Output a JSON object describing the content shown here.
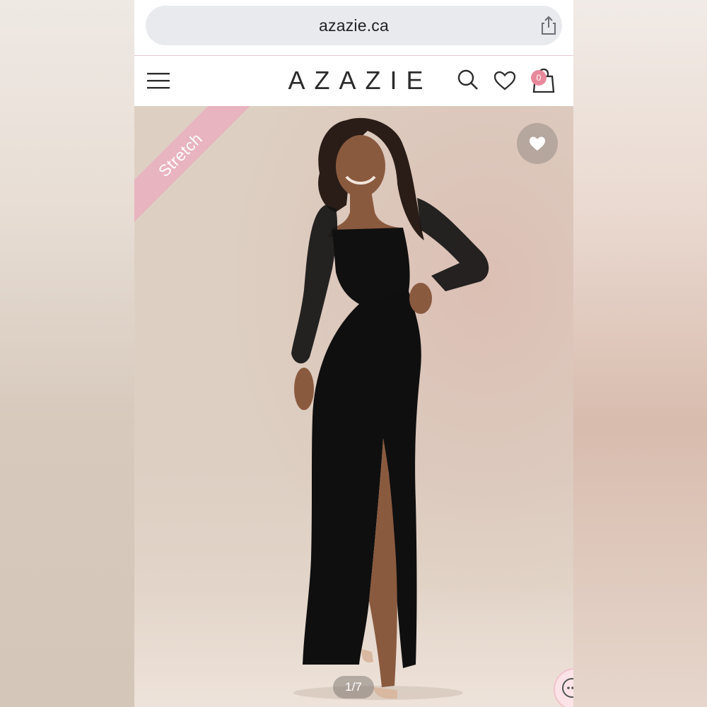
{
  "browser": {
    "url": "azazie.ca"
  },
  "header": {
    "brand": "AZAZIE",
    "cart_count": "0"
  },
  "hero": {
    "badge": "Stretch",
    "pager": "1/7"
  },
  "colors": {
    "accent_pink": "#e8b4bf",
    "badge_pink": "#e8899b",
    "url_bar_bg": "#e8eaed"
  },
  "icons": [
    "share-icon",
    "menu-icon",
    "search-icon",
    "heart-icon",
    "bag-icon",
    "wishlist-heart-icon",
    "chat-icon"
  ]
}
